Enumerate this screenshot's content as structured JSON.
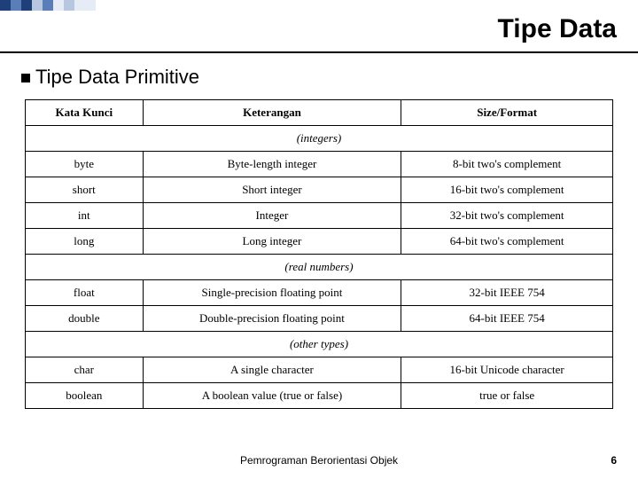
{
  "title": "Tipe Data",
  "subtitle": "Tipe Data Primitive",
  "table": {
    "headers": [
      "Kata Kunci",
      "Keterangan",
      "Size/Format"
    ],
    "groups": [
      {
        "label": "(integers)",
        "rows": [
          [
            "byte",
            "Byte-length integer",
            "8-bit two's complement"
          ],
          [
            "short",
            "Short integer",
            "16-bit two's complement"
          ],
          [
            "int",
            "Integer",
            "32-bit two's complement"
          ],
          [
            "long",
            "Long integer",
            "64-bit two's complement"
          ]
        ]
      },
      {
        "label": "(real numbers)",
        "rows": [
          [
            "float",
            "Single-precision floating point",
            "32-bit IEEE 754"
          ],
          [
            "double",
            "Double-precision floating point",
            "64-bit IEEE 754"
          ]
        ]
      },
      {
        "label": "(other types)",
        "rows": [
          [
            "char",
            "A single character",
            "16-bit Unicode character"
          ],
          [
            "boolean",
            "A boolean value (true or false)",
            "true or false"
          ]
        ]
      }
    ]
  },
  "footer": "Pemrograman Berorientasi Objek",
  "page_number": "6"
}
